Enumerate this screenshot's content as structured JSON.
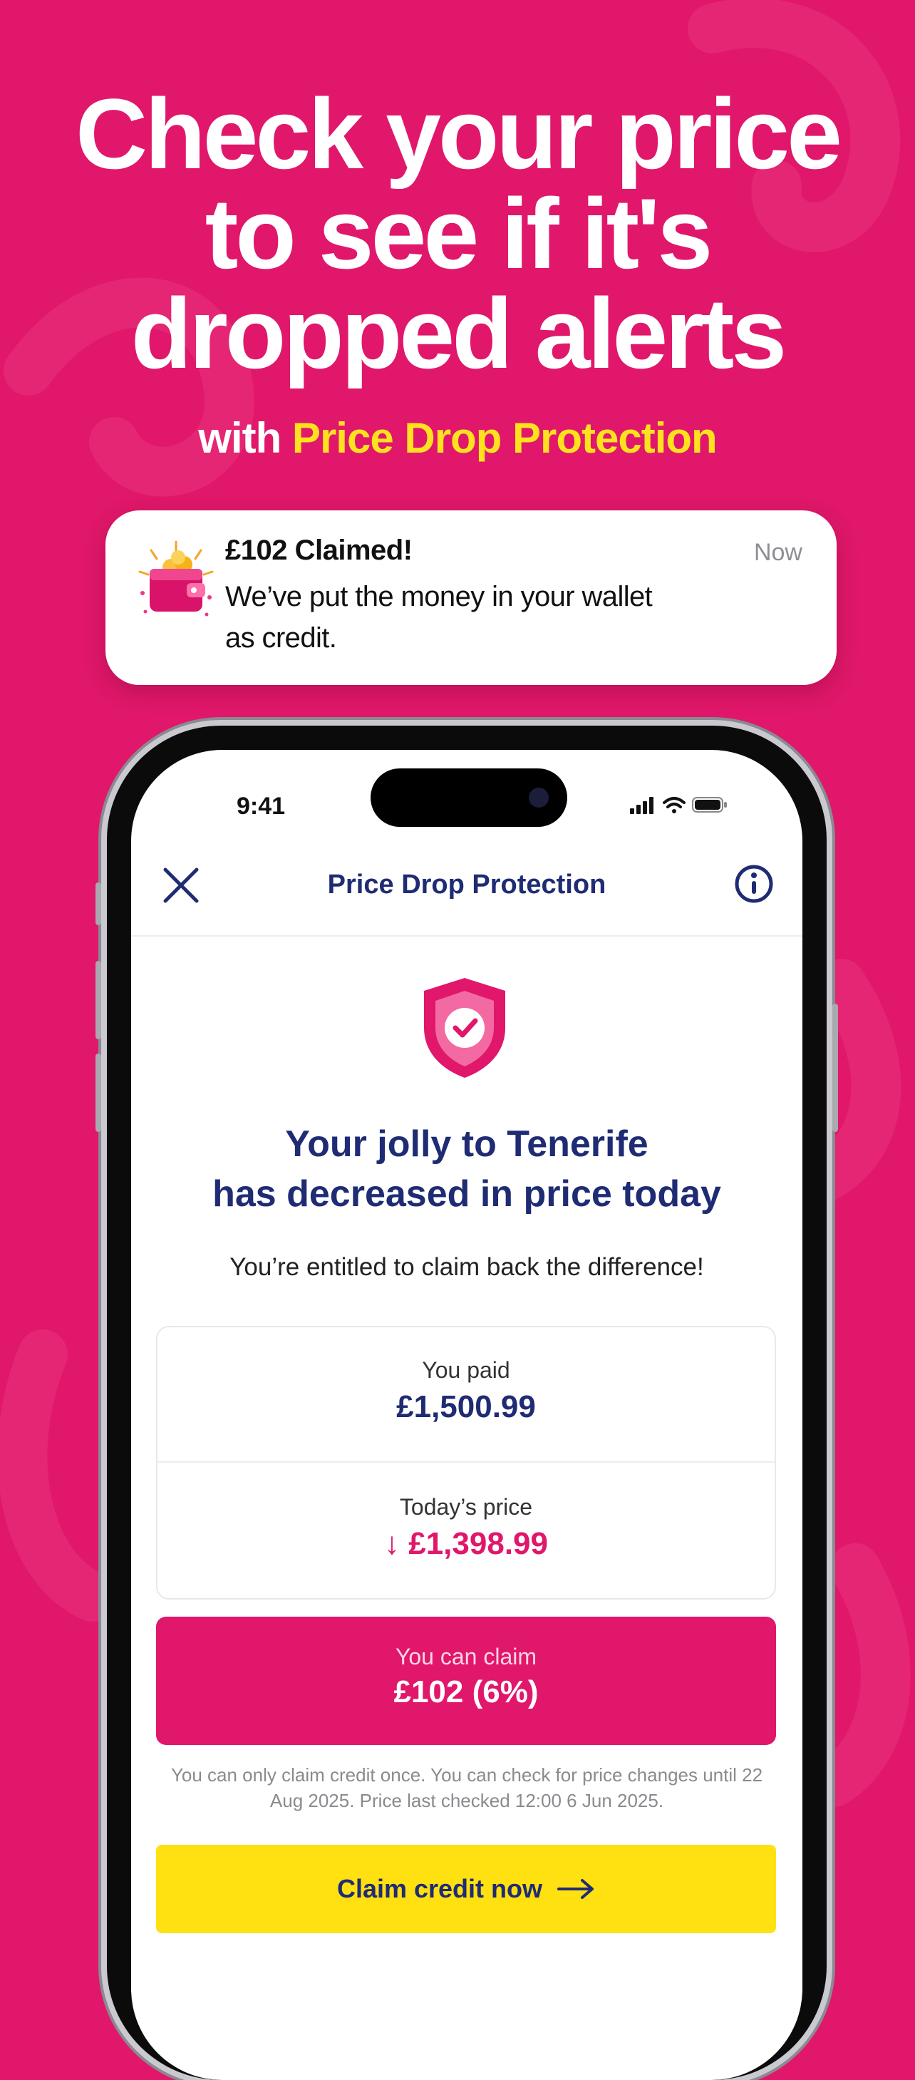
{
  "headline": {
    "lines": [
      "Check your price",
      "to see if it's",
      "dropped alerts"
    ],
    "sub_prefix": "with",
    "sub_accent": "Price Drop Protection"
  },
  "notification": {
    "icon": "wallet-coins-icon",
    "title": "£102 Claimed!",
    "time": "Now",
    "body": "We’ve put the money in your wallet as credit."
  },
  "status_bar": {
    "time": "9:41",
    "icons": [
      "signal-icon",
      "wifi-icon",
      "battery-icon"
    ]
  },
  "nav": {
    "title": "Price Drop Protection",
    "close_icon": "close-icon",
    "info_icon": "info-icon"
  },
  "main": {
    "title_lines": [
      "Your jolly to Tenerife",
      "has decreased in price today"
    ],
    "entitled": "You’re entitled to claim back the difference!",
    "paid_label": "You paid",
    "paid_value": "£1,500.99",
    "today_label": "Today’s price",
    "today_value": "↓ £1,398.99",
    "claim_label": "You can claim",
    "claim_value": "£102 (6%)",
    "fineprint": "You can only claim credit once. You can check for price changes until 22 Aug 2025. Price last checked 12:00 6 Jun 2025.",
    "cta_label": "Claim credit now"
  },
  "colors": {
    "background": "#E0176A",
    "accent_yellow": "#FFE21F",
    "navy": "#1F2C73",
    "cta": "#FFE010"
  }
}
